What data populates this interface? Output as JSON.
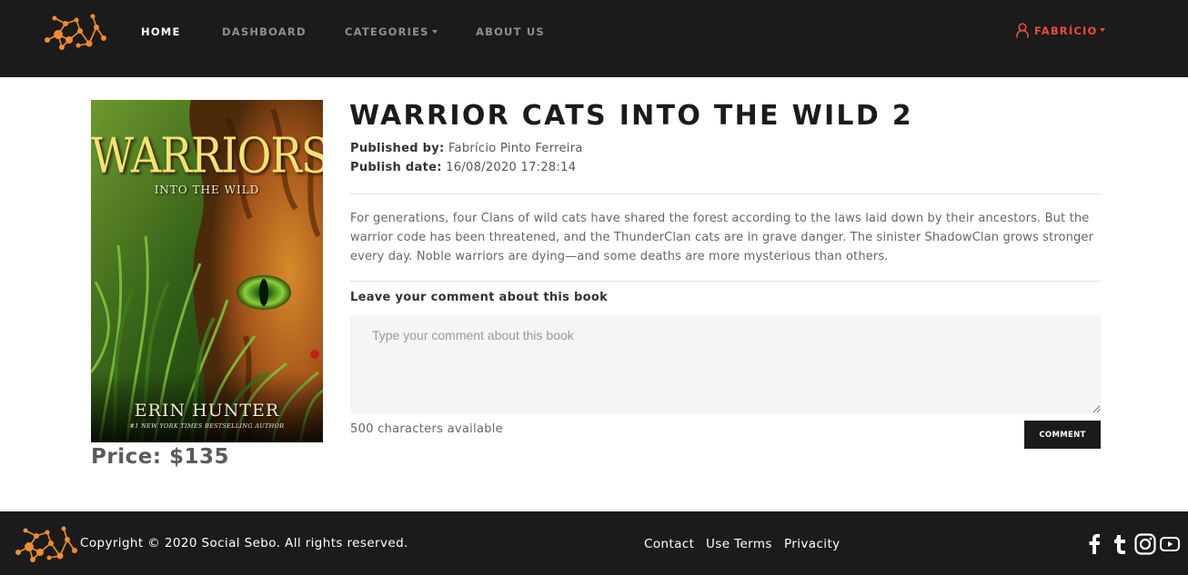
{
  "navbar": {
    "logo_name": "network-logo",
    "links": [
      "HOME",
      "DASHBOARD",
      "CATEGORIES",
      "ABOUT US"
    ],
    "user": "FABRÍCIO"
  },
  "book": {
    "cover": {
      "title": "WARRIORS",
      "subtitle": "INTO THE WILD",
      "author": "ERIN HUNTER",
      "tagline": "#1 NEW YORK TIMES BESTSELLING AUTHOR"
    },
    "price": "Price: $135",
    "title": "WARRIOR CATS INTO THE WILD 2",
    "published_by_label": "Published by:",
    "published_by": "Fabrício Pinto Ferreira",
    "publish_date_label": "Publish date:",
    "publish_date": "16/08/2020 17:28:14",
    "description": "For generations, four Clans of wild cats have shared the forest according to the laws laid down by their ancestors. But the warrior code has been threatened, and the ThunderClan cats are in grave danger. The sinister ShadowClan grows stronger every day. Noble warriors are dying—and some deaths are more mysterious than others."
  },
  "comment": {
    "label": "Leave your comment about this book",
    "placeholder": "Type your comment about this book",
    "value": "",
    "chars_available": "500 characters available",
    "button": "COMMENT"
  },
  "footer": {
    "copyright": "Copyright © 2020 Social Sebo. All rights reserved.",
    "links": [
      "Contact",
      "Use Terms",
      "Privacity"
    ],
    "social_icons": [
      "facebook-icon",
      "tumblr-icon",
      "instagram-icon",
      "youtube-icon"
    ]
  },
  "colors": {
    "dark": "#1b1b1b",
    "accent": "#f04a3c",
    "logo_orange": "#f28c2e"
  }
}
